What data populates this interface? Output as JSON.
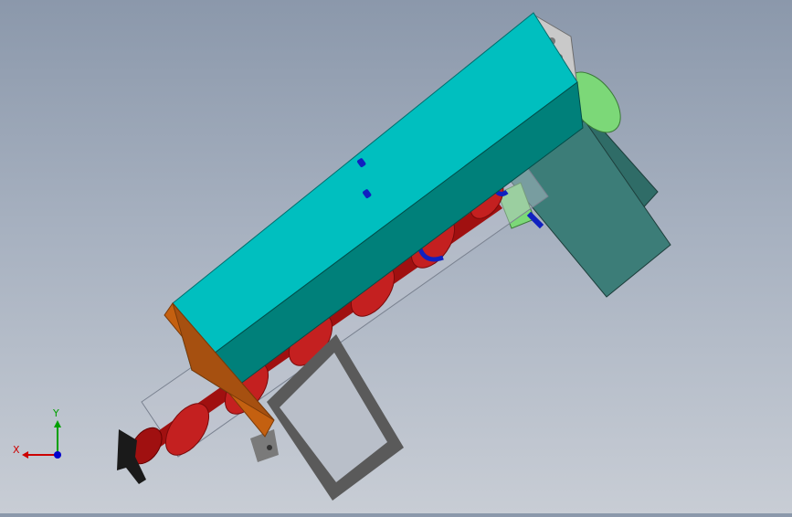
{
  "triad": {
    "x_label": "X",
    "y_label": "Y",
    "x_color": "#cc0000",
    "y_color": "#00a000",
    "z_color": "#0000cc"
  },
  "colors": {
    "trough_top": "#00bfbf",
    "trough_side": "#00807a",
    "end_plate": "#c46010",
    "auger": "#b01818",
    "auger_light": "#d84040",
    "motor_body": "#3c7d78",
    "flange": "#7cd878",
    "frame": "#5a5a5a",
    "bolt": "#1020c0",
    "handle": "#1a1a1a"
  }
}
